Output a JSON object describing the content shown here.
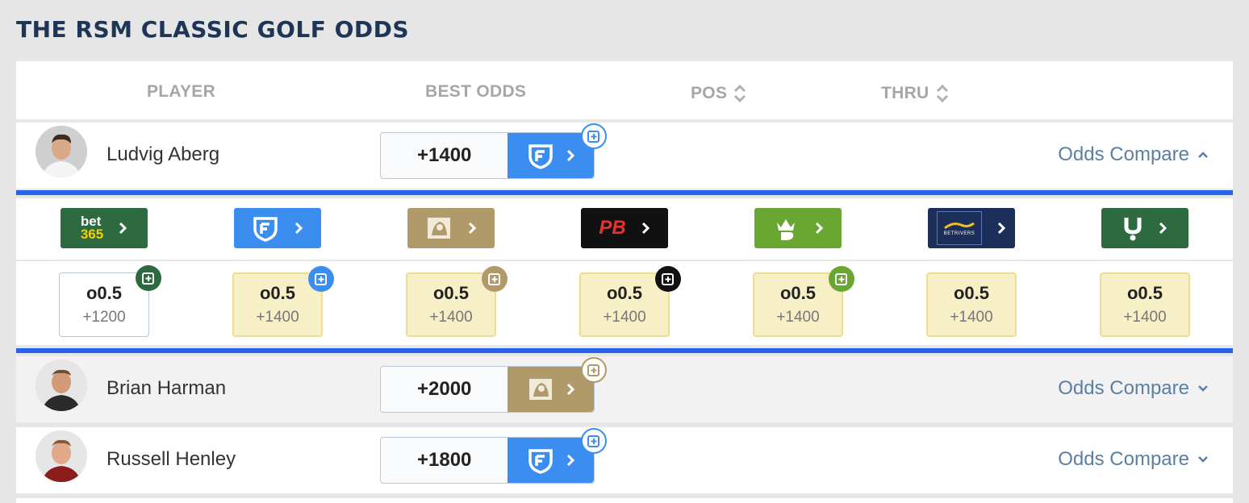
{
  "page": {
    "title": "THE RSM CLASSIC GOLF ODDS"
  },
  "columns": {
    "player": "PLAYER",
    "best_odds": "BEST ODDS",
    "pos": "POS",
    "thru": "THRU"
  },
  "players": [
    {
      "name": "Ludvig Aberg",
      "best_odds": "+1400",
      "book": "fanduel",
      "compare_label": "Odds Compare",
      "expanded": true
    },
    {
      "name": "Brian Harman",
      "best_odds": "+2000",
      "book": "betmgm",
      "compare_label": "Odds Compare",
      "expanded": false
    },
    {
      "name": "Russell Henley",
      "best_odds": "+1800",
      "book": "fanduel",
      "compare_label": "Odds Compare",
      "expanded": false
    }
  ],
  "books": [
    {
      "id": "bet365",
      "name_line1": "bet",
      "name_line2": "365",
      "color": "#2d6a3f"
    },
    {
      "id": "fanduel",
      "color": "#3b8ef0"
    },
    {
      "id": "betmgm",
      "color": "#b09a6a"
    },
    {
      "id": "pointsbet",
      "name": "PB",
      "color": "#111111"
    },
    {
      "id": "draftkings",
      "color": "#6aa732"
    },
    {
      "id": "betrivers",
      "name": "BETRIVERS",
      "color": "#1c2e5a"
    },
    {
      "id": "unibet",
      "color": "#2d6a3f"
    }
  ],
  "expanded_odds": [
    {
      "line": "o0.5",
      "price": "+1200"
    },
    {
      "line": "o0.5",
      "price": "+1400"
    },
    {
      "line": "o0.5",
      "price": "+1400"
    },
    {
      "line": "o0.5",
      "price": "+1400"
    },
    {
      "line": "o0.5",
      "price": "+1400"
    },
    {
      "line": "o0.5",
      "price": "+1400"
    },
    {
      "line": "o0.5",
      "price": "+1400"
    }
  ],
  "colors": {
    "accent_blue": "#2563eb",
    "title_navy": "#1d3557",
    "link": "#5a7fa3",
    "best_cell": "#f7efc6"
  }
}
